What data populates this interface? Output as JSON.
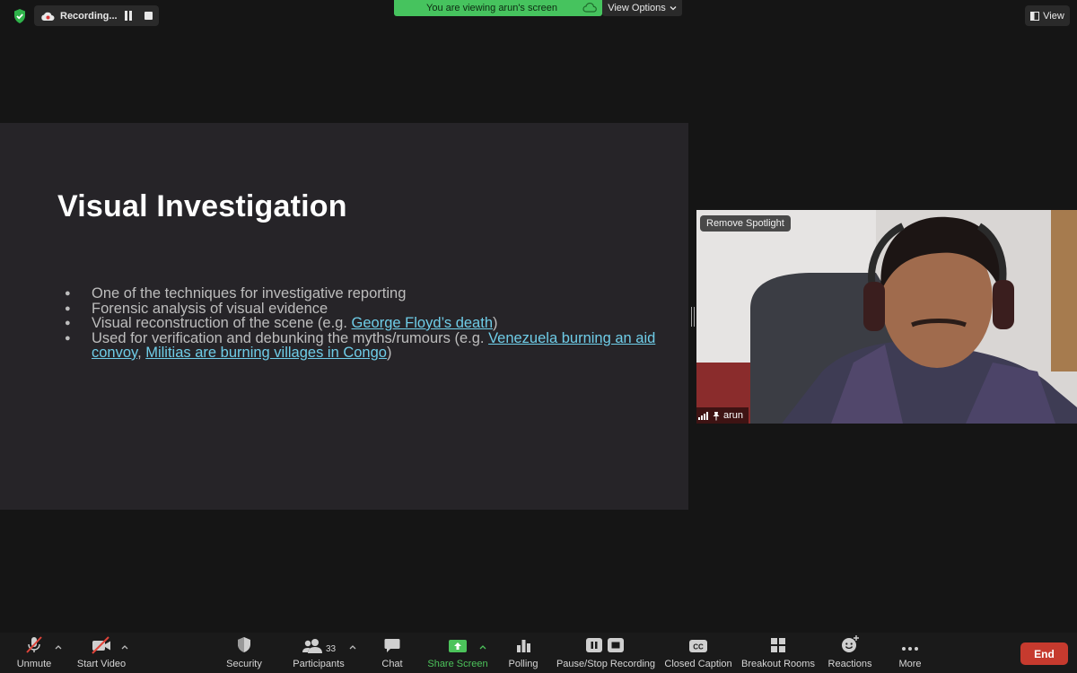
{
  "colors": {
    "background": "#151515",
    "slide_background": "#262428",
    "green_banner": "#46c35e",
    "link": "#6fcde8",
    "end_button": "#c63a2e",
    "share_screen_green": "#4cc35b"
  },
  "top_bar": {
    "recording_label": "Recording...",
    "viewing_text": "You are viewing arun's screen",
    "view_options_label": "View Options",
    "view_label": "View"
  },
  "slide": {
    "title": "Visual Investigation",
    "bullets": [
      {
        "text": "One of the techniques for investigative reporting"
      },
      {
        "text": "Forensic analysis of visual evidence"
      },
      {
        "prefix": "Visual reconstruction of the scene (e.g. ",
        "link": "George Floyd’s death",
        "suffix": ")"
      },
      {
        "prefix": "Used for verification and debunking the myths/rumours (e.g. ",
        "link": "Venezuela burning an aid convoy",
        "middle": ", ",
        "link2": "Militias are burning villages in Congo",
        "suffix": ")"
      }
    ]
  },
  "video": {
    "remove_spotlight_label": "Remove Spotlight",
    "participant_name": "arun"
  },
  "toolbar": {
    "unmute": "Unmute",
    "start_video": "Start Video",
    "security": "Security",
    "participants": "Participants",
    "participant_count": "33",
    "chat": "Chat",
    "share_screen": "Share Screen",
    "polling": "Polling",
    "pause_stop_recording": "Pause/Stop Recording",
    "closed_caption": "Closed Caption",
    "breakout_rooms": "Breakout Rooms",
    "reactions": "Reactions",
    "more": "More",
    "end": "End"
  }
}
